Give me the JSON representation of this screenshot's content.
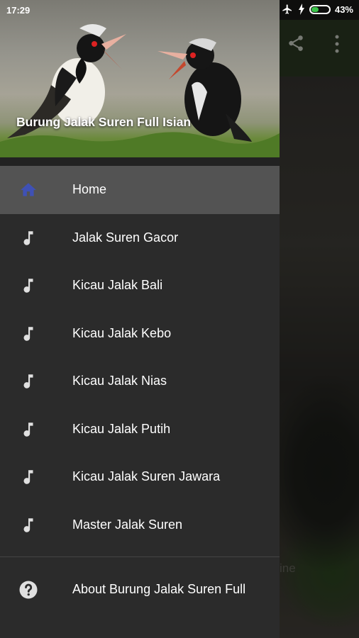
{
  "status_bar": {
    "time": "17:29",
    "battery_percent": "43%",
    "battery_level": 0.43,
    "icons": [
      "airplane-icon",
      "charging-icon",
      "battery-icon"
    ]
  },
  "background_app": {
    "actions": [
      "share-icon",
      "more-vert-icon"
    ],
    "faint_text": "ine",
    "toolbar_color": "#2f3d26"
  },
  "drawer": {
    "header": {
      "title": "Burung Jalak Suren Full Isian"
    },
    "items": [
      {
        "label": "Home",
        "icon": "home-icon",
        "active": true
      },
      {
        "label": "Jalak Suren Gacor",
        "icon": "music-note-icon",
        "active": false
      },
      {
        "label": "Kicau Jalak Bali",
        "icon": "music-note-icon",
        "active": false
      },
      {
        "label": "Kicau Jalak Kebo",
        "icon": "music-note-icon",
        "active": false
      },
      {
        "label": "Kicau Jalak Nias",
        "icon": "music-note-icon",
        "active": false
      },
      {
        "label": "Kicau Jalak Putih",
        "icon": "music-note-icon",
        "active": false
      },
      {
        "label": "Kicau Jalak Suren Jawara",
        "icon": "music-note-icon",
        "active": false
      },
      {
        "label": "Master Jalak Suren",
        "icon": "music-note-icon",
        "active": false
      }
    ],
    "about": {
      "label": "About Burung Jalak Suren Full",
      "icon": "help-circle-icon"
    },
    "colors": {
      "background": "#2b2b2b",
      "active": "#535353",
      "home_icon": "#3f51b5"
    }
  }
}
